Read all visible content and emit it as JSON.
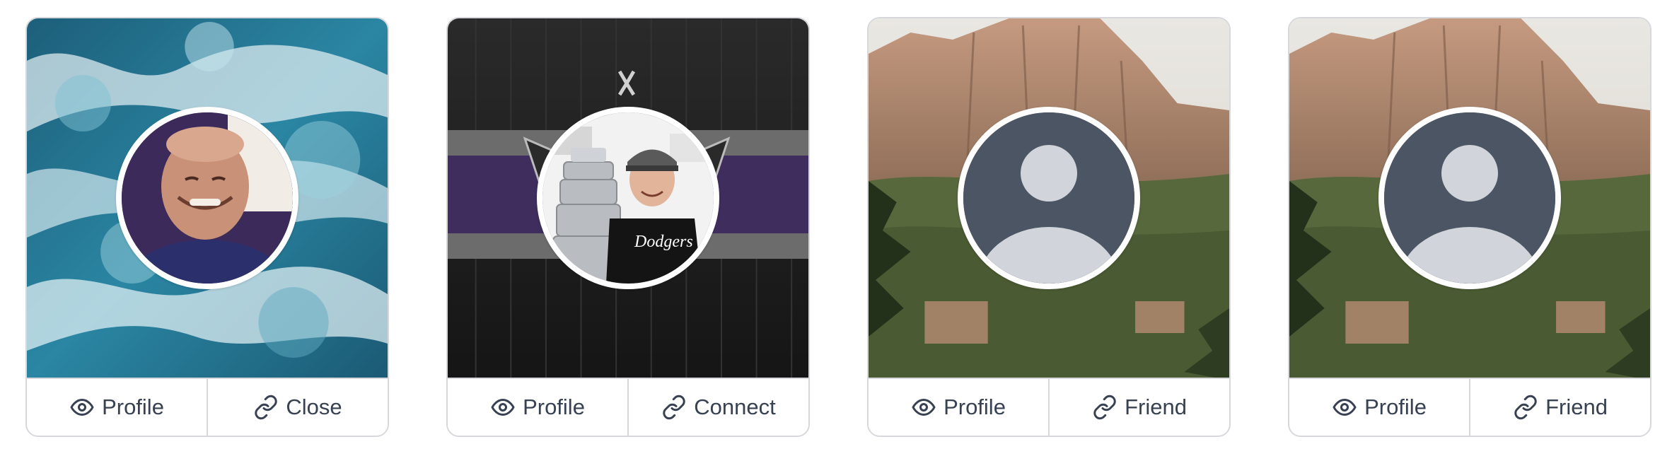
{
  "cards": [
    {
      "cover": "ocean-waves",
      "avatar": "photo-smiling-man",
      "actions": [
        {
          "icon": "eye-icon",
          "label": "Profile"
        },
        {
          "icon": "link-icon",
          "label": "Close"
        }
      ]
    },
    {
      "cover": "dark-wood-purple-stripe",
      "avatar": "photo-teen-with-trophy",
      "avatar_shirt_text": "Dodgers",
      "actions": [
        {
          "icon": "eye-icon",
          "label": "Profile"
        },
        {
          "icon": "link-icon",
          "label": "Connect"
        }
      ]
    },
    {
      "cover": "mountain-cliff",
      "avatar": "default-avatar",
      "actions": [
        {
          "icon": "eye-icon",
          "label": "Profile"
        },
        {
          "icon": "link-icon",
          "label": "Friend"
        }
      ]
    },
    {
      "cover": "mountain-cliff",
      "avatar": "default-avatar",
      "actions": [
        {
          "icon": "eye-icon",
          "label": "Profile"
        },
        {
          "icon": "link-icon",
          "label": "Friend"
        }
      ]
    }
  ],
  "colors": {
    "border": "#d6d8dc",
    "text": "#374151",
    "default_avatar_bg": "#4b5563",
    "default_avatar_fg": "#d1d5db",
    "stripe_purple": "#3f2d5e"
  }
}
